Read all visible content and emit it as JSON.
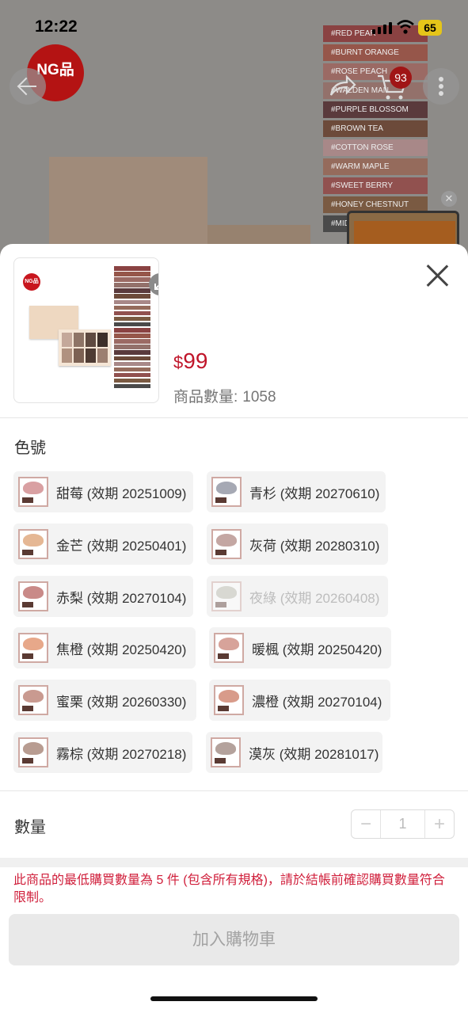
{
  "status_bar": {
    "time": "12:22",
    "battery": "65"
  },
  "background": {
    "ng_badge": "NG品",
    "cart_count": "93",
    "swatches": [
      {
        "label": "#RED PEAR",
        "color": "#8a4242"
      },
      {
        "label": "#BURNT ORANGE",
        "color": "#96564a"
      },
      {
        "label": "#ROSE PEACH",
        "color": "#9b6a64"
      },
      {
        "label": "#WALDEN MAN",
        "color": "#93716b"
      },
      {
        "label": "#PURPLE BLOSSOM",
        "color": "#5a3a3c"
      },
      {
        "label": "#BROWN TEA",
        "color": "#6c4a3a"
      },
      {
        "label": "#COTTON ROSE",
        "color": "#a88888"
      },
      {
        "label": "#WARM MAPLE",
        "color": "#956b5c"
      },
      {
        "label": "#SWEET BERRY",
        "color": "#91514f"
      },
      {
        "label": "#HONEY CHESTNUT",
        "color": "#7a5a42"
      },
      {
        "label": "#MID",
        "color": "#4a4a4a"
      }
    ]
  },
  "sheet": {
    "thumb_badge": "NG品",
    "price_currency": "$",
    "price_amount": "99",
    "stock_label": "商品數量:",
    "stock_value": "1058",
    "color_section_label": "色號",
    "options": [
      {
        "label": "甜莓 (效期 20251009)",
        "color": "#d9a0a2",
        "disabled": false
      },
      {
        "label": "青杉 (效期 20270610)",
        "color": "#a6a9b4",
        "disabled": false
      },
      {
        "label": "金芒 (效期 20250401)",
        "color": "#e5b794",
        "disabled": false
      },
      {
        "label": "灰荷 (效期 20280310)",
        "color": "#c4a7a3",
        "disabled": false
      },
      {
        "label": "赤梨 (效期 20270104)",
        "color": "#c98a88",
        "disabled": false
      },
      {
        "label": "夜綠 (效期 20260408)",
        "color": "#b8b8ab",
        "disabled": true
      },
      {
        "label": "焦橙 (效期 20250420)",
        "color": "#e7a88a",
        "disabled": false
      },
      {
        "label": "暖楓 (效期 20250420)",
        "color": "#d7a39a",
        "disabled": false
      },
      {
        "label": "蜜栗 (效期 20260330)",
        "color": "#c99a90",
        "disabled": false
      },
      {
        "label": "濃橙 (效期 20270104)",
        "color": "#d89b8a",
        "disabled": false
      },
      {
        "label": "霧棕 (效期 20270218)",
        "color": "#b89c91",
        "disabled": false
      },
      {
        "label": "漠灰 (效期 20281017)",
        "color": "#b4a29c",
        "disabled": false
      }
    ],
    "quantity_label": "數量",
    "quantity_minus": "−",
    "quantity_value": "1",
    "quantity_plus": "+",
    "notice": "此商品的最低購買數量為 5 件 (包含所有規格)，請於結帳前確認購買數量符合限制。",
    "add_to_cart": "加入購物車"
  }
}
